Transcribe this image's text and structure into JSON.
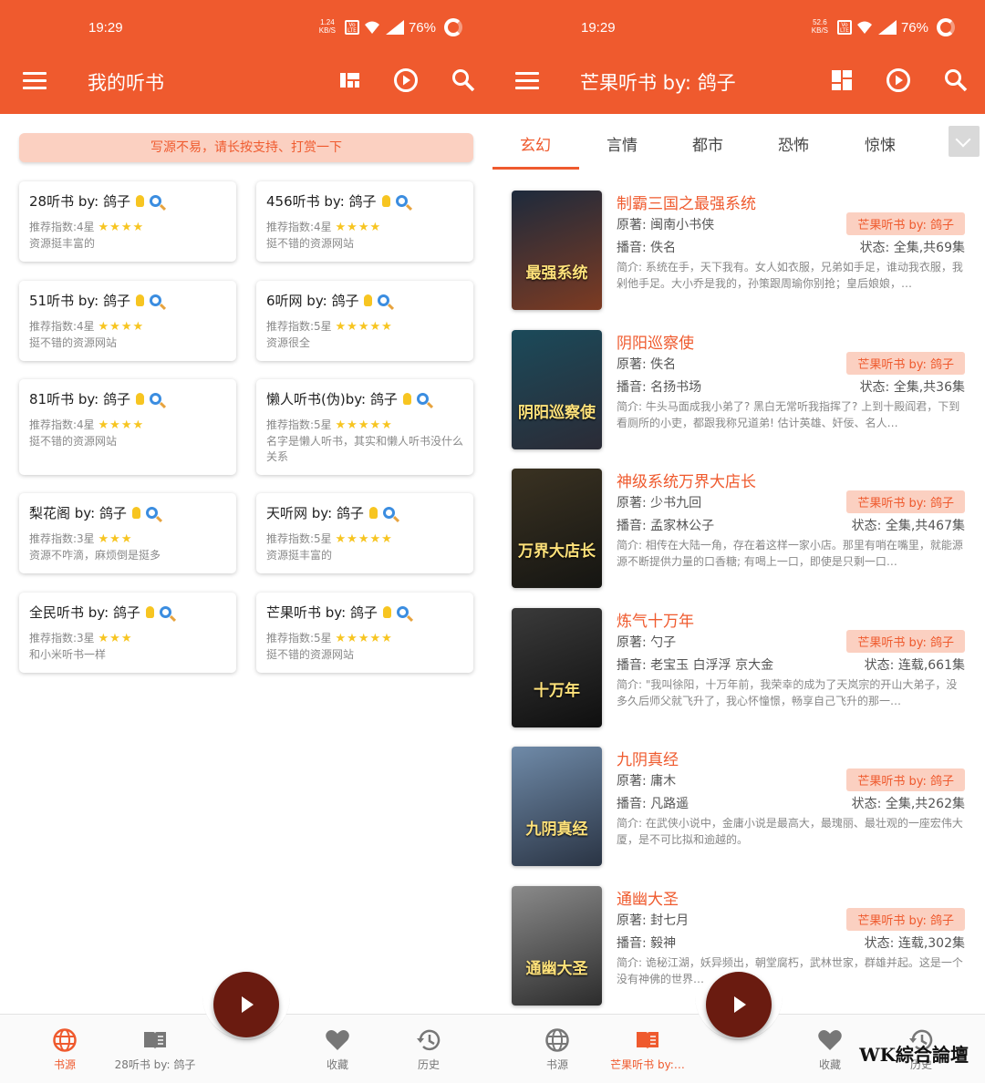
{
  "left": {
    "status": {
      "time": "19:29",
      "net_value": "1.24",
      "net_unit": "KB/S",
      "battery": "76%"
    },
    "title": "我的听书",
    "banner": "写源不易，请长按支持、打赏一下",
    "cards": [
      {
        "title": "28听书 by: 鸽子",
        "rec": "推荐指数:4星",
        "stars": "★★★★",
        "desc": "资源挺丰富的"
      },
      {
        "title": "456听书 by: 鸽子",
        "rec": "推荐指数:4星",
        "stars": "★★★★",
        "desc": "挺不错的资源网站"
      },
      {
        "title": "51听书 by: 鸽子",
        "rec": "推荐指数:4星",
        "stars": "★★★★",
        "desc": "挺不错的资源网站"
      },
      {
        "title": "6听网 by: 鸽子",
        "rec": "推荐指数:5星",
        "stars": "★★★★★",
        "desc": "资源很全"
      },
      {
        "title": "81听书 by: 鸽子",
        "rec": "推荐指数:4星",
        "stars": "★★★★",
        "desc": "挺不错的资源网站"
      },
      {
        "title": "懒人听书(伪)by: 鸽子",
        "rec": "推荐指数:5星",
        "stars": "★★★★★",
        "desc": "名字是懒人听书，其实和懒人听书没什么关系"
      },
      {
        "title": "梨花阁 by: 鸽子",
        "rec": "推荐指数:3星",
        "stars": "★★★",
        "desc": "资源不咋滴，麻烦倒是挺多"
      },
      {
        "title": "天听网 by: 鸽子",
        "rec": "推荐指数:5星",
        "stars": "★★★★★",
        "desc": "资源挺丰富的"
      },
      {
        "title": "全民听书 by: 鸽子",
        "rec": "推荐指数:3星",
        "stars": "★★★",
        "desc": "和小米听书一样"
      },
      {
        "title": "芒果听书 by: 鸽子",
        "rec": "推荐指数:5星",
        "stars": "★★★★★",
        "desc": "挺不错的资源网站"
      }
    ],
    "nav": [
      "书源",
      "28听书 by: 鸽子",
      "收藏",
      "历史"
    ]
  },
  "right": {
    "status": {
      "time": "19:29",
      "net_value": "52.6",
      "net_unit": "KB/S",
      "battery": "76%"
    },
    "title": "芒果听书 by: 鸽子",
    "tabs": [
      "玄幻",
      "言情",
      "都市",
      "恐怖",
      "惊悚"
    ],
    "books": [
      {
        "title": "制霸三国之最强系统",
        "author": "原著: 闽南小书侠",
        "tag": "芒果听书 by: 鸽子",
        "narrator": "播音: 佚名",
        "status": "状态: 全集,共69集",
        "intro": "简介: 系统在手，天下我有。女人如衣服，兄弟如手足，谁动我衣服，我剁他手足。大小乔是我的，孙策跟周瑜你别抢；皇后娘娘，…",
        "cover_text": "最强系统",
        "c1": "#1d2a3c",
        "c2": "#7d3b22"
      },
      {
        "title": "阴阳巡察使",
        "author": "原著: 佚名",
        "tag": "芒果听书 by: 鸽子",
        "narrator": "播音: 名扬书场",
        "status": "状态: 全集,共36集",
        "intro": "简介: 牛头马面成我小弟了? 黑白无常听我指挥了? 上到十殿阎君，下到看厕所的小吏，都跟我称兄道弟! 估计英雄、奸佞、名人…",
        "cover_text": "阴阳巡察使",
        "c1": "#1b4a5a",
        "c2": "#2b2b36"
      },
      {
        "title": "神级系统万界大店长",
        "author": "原著: 少书九回",
        "tag": "芒果听书 by: 鸽子",
        "narrator": "播音: 孟家林公子",
        "status": "状态: 全集,共467集",
        "intro": "简介: 相传在大陆一角，存在着这样一家小店。那里有哨在嘴里，就能源源不断提供力量的口香糖; 有喝上一口，即使是只剩一口…",
        "cover_text": "万界大店长",
        "c1": "#3a3222",
        "c2": "#151512"
      },
      {
        "title": "炼气十万年",
        "author": "原著: 勺子",
        "tag": "芒果听书 by: 鸽子",
        "narrator": "播音: 老宝玉 白浮浮 京大金",
        "status": "状态: 连载,661集",
        "intro": "简介: \"我叫徐阳，十万年前，我荣幸的成为了天岚宗的开山大弟子，没多久后师父就飞升了，我心怀憧憬，畅享自己飞升的那一…",
        "cover_text": "十万年",
        "c1": "#3a3a3a",
        "c2": "#0f0f0f"
      },
      {
        "title": "九阴真经",
        "author": "原著: 庸木",
        "tag": "芒果听书 by: 鸽子",
        "narrator": "播音: 凡路遥",
        "status": "状态: 全集,共262集",
        "intro": "简介: 在武侠小说中，金庸小说是最高大，最瑰丽、最壮观的一座宏伟大厦，是不可比拟和逾越的。",
        "cover_text": "九阴真经",
        "c1": "#6f8aa8",
        "c2": "#2a3444"
      },
      {
        "title": "通幽大圣",
        "author": "原著: 封七月",
        "tag": "芒果听书 by: 鸽子",
        "narrator": "播音: 毅神",
        "status": "状态: 连载,302集",
        "intro": "简介: 诡秘江湖，妖异频出，朝堂腐朽，武林世家，群雄并起。这是一个没有神佛的世界…",
        "cover_text": "通幽大圣",
        "c1": "#8a8a8a",
        "c2": "#2c2c2c"
      }
    ],
    "nav": [
      "书源",
      "芒果听书 by:…",
      "收藏",
      "历史"
    ]
  },
  "watermark": "WK綜合論壇",
  "colors": {
    "accent": "#ef5a2e",
    "fab": "#6a1b10",
    "tag_bg": "#fbd0c1"
  }
}
